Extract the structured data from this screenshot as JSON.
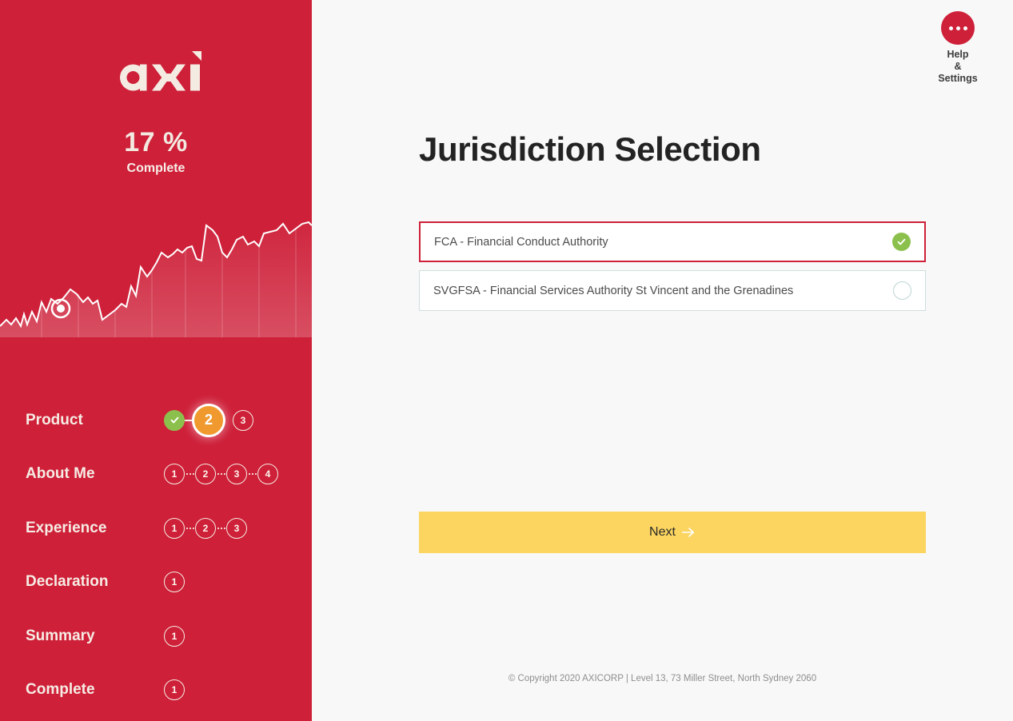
{
  "brand": {
    "logo_text": "axi",
    "primary_color": "#ce2039",
    "accent_yellow": "#fbd55f",
    "accent_green": "#8cc04c",
    "accent_orange": "#f0992e"
  },
  "sidebar": {
    "progress_percent": "17 %",
    "progress_label": "Complete",
    "steps": [
      {
        "label": "Product",
        "dots": [
          {
            "value": "",
            "state": "done"
          },
          {
            "value": "2",
            "state": "active"
          },
          {
            "value": "3",
            "state": "todo"
          }
        ]
      },
      {
        "label": "About Me",
        "dots": [
          {
            "value": "1",
            "state": "todo"
          },
          {
            "value": "2",
            "state": "todo"
          },
          {
            "value": "3",
            "state": "todo"
          },
          {
            "value": "4",
            "state": "todo"
          }
        ]
      },
      {
        "label": "Experience",
        "dots": [
          {
            "value": "1",
            "state": "todo"
          },
          {
            "value": "2",
            "state": "todo"
          },
          {
            "value": "3",
            "state": "todo"
          }
        ]
      },
      {
        "label": "Declaration",
        "dots": [
          {
            "value": "1",
            "state": "todo"
          }
        ]
      },
      {
        "label": "Summary",
        "dots": [
          {
            "value": "1",
            "state": "todo"
          }
        ]
      },
      {
        "label": "Complete",
        "dots": [
          {
            "value": "1",
            "state": "todo"
          }
        ]
      }
    ]
  },
  "header": {
    "help_icon": "ellipsis-icon",
    "help_line1": "Help",
    "help_line2": "&",
    "help_line3": "Settings"
  },
  "main": {
    "title": "Jurisdiction Selection",
    "options": [
      {
        "label": "FCA - Financial Conduct Authority",
        "selected": true,
        "icon": "check-circle-icon"
      },
      {
        "label": "SVGFSA - Financial Services Authority St Vincent and the Grenadines",
        "selected": false,
        "icon": "radio-empty-icon"
      }
    ],
    "next_label": "Next",
    "next_icon": "arrow-right-icon"
  },
  "footer": {
    "copyright": "© Copyright 2020 AXICORP | Level 13, 73 Miller Street, North Sydney 2060"
  }
}
